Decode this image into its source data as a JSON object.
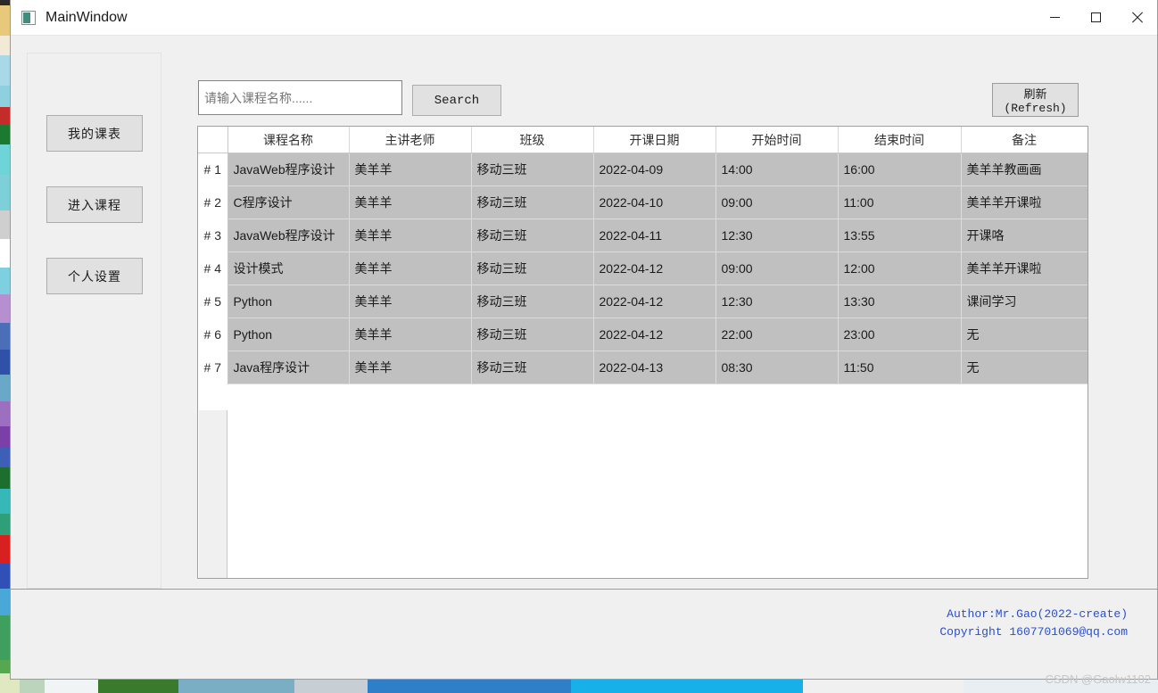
{
  "window": {
    "title": "MainWindow",
    "icon": "app-icon",
    "controls": {
      "minimize": "minimize-icon",
      "maximize": "maximize-icon",
      "close": "close-icon"
    }
  },
  "sidebar": {
    "buttons": [
      {
        "id": "my-schedule",
        "label": "我的课表"
      },
      {
        "id": "enter-course",
        "label": "进入课程"
      },
      {
        "id": "personal-settings",
        "label": "个人设置"
      }
    ]
  },
  "toolbar": {
    "search_value": "",
    "search_placeholder": "请输入课程名称......",
    "search_label": "Search",
    "refresh_label": "刷新(Refresh)"
  },
  "table": {
    "index_header": "",
    "columns": [
      "课程名称",
      "主讲老师",
      "班级",
      "开课日期",
      "开始时间",
      "结束时间",
      "备注"
    ],
    "rows": [
      {
        "index": "# 1",
        "selected": false,
        "cells": [
          "JavaWeb程序设计",
          "美羊羊",
          "移动三班",
          "2022-04-09",
          "14:00",
          "16:00",
          "美羊羊教画画"
        ]
      },
      {
        "index": "# 2",
        "selected": false,
        "cells": [
          "C程序设计",
          "美羊羊",
          "移动三班",
          "2022-04-10",
          "09:00",
          "11:00",
          "美羊羊开课啦"
        ]
      },
      {
        "index": "# 3",
        "selected": false,
        "cells": [
          "JavaWeb程序设计",
          "美羊羊",
          "移动三班",
          "2022-04-11",
          "12:30",
          "13:55",
          "开课咯"
        ]
      },
      {
        "index": "# 4",
        "selected": false,
        "cells": [
          "设计模式",
          "美羊羊",
          "移动三班",
          "2022-04-12",
          "09:00",
          "12:00",
          "美羊羊开课啦"
        ]
      },
      {
        "index": "# 5",
        "selected": false,
        "cells": [
          "Python",
          "美羊羊",
          "移动三班",
          "2022-04-12",
          "12:30",
          "13:30",
          "课间学习"
        ]
      },
      {
        "index": "# 6",
        "selected": false,
        "cells": [
          "Python",
          "美羊羊",
          "移动三班",
          "2022-04-12",
          "22:00",
          "23:00",
          "无"
        ]
      },
      {
        "index": "# 7",
        "selected": true,
        "cells": [
          "Java程序设计",
          "美羊羊",
          "移动三班",
          "2022-04-13",
          "08:30",
          "11:50",
          "无"
        ]
      }
    ]
  },
  "footer": {
    "author": "Author:Mr.Gao(2022-create)",
    "copyright": "Copyright 1607701069@qq.com"
  },
  "watermark": "CSDN @Gaolw1102",
  "colors": {
    "selected_row": "#00ee00",
    "cell_background": "#c0c0c0",
    "credit_text": "#2a4fcf",
    "window_chrome": "#f0f0f0"
  }
}
